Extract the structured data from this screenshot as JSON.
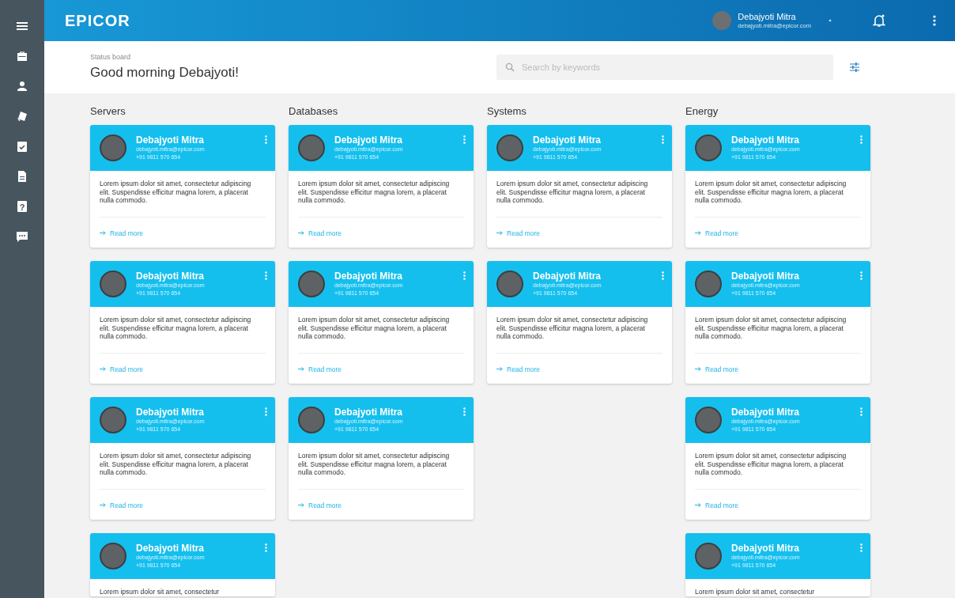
{
  "topbar": {
    "logo": "EPICOR",
    "user": {
      "name": "Debajyoti Mitra",
      "email": "debajyoti.mitra@epicor.com"
    }
  },
  "sidebar": {
    "items": [
      {
        "kind": "menu"
      },
      {
        "kind": "briefcase"
      },
      {
        "kind": "person"
      },
      {
        "kind": "tag"
      },
      {
        "kind": "clipboard"
      },
      {
        "kind": "document"
      },
      {
        "kind": "help",
        "glyph": "?"
      },
      {
        "kind": "chat"
      }
    ]
  },
  "page": {
    "breadcrumb": "Status board",
    "greeting": "Good morning Debajyoti!",
    "search": {
      "placeholder": "Search by keywords"
    }
  },
  "columns": [
    {
      "title": "Servers",
      "cards": [
        {
          "name": "Debajyoti Mitra",
          "email": "debajyoti.mitra@epicor.com",
          "phone": "+91 9811 570 654",
          "text": "Lorem ipsum dolor sit amet, consectetur adipiscing elit. Suspendisse efficitur magna lorem, a placerat nulla commodo.",
          "link": "Read more"
        },
        {
          "name": "Debajyoti Mitra",
          "email": "debajyoti.mitra@epicor.com",
          "phone": "+91 9811 570 654",
          "text": "Lorem ipsum dolor sit amet, consectetur adipiscing elit. Suspendisse efficitur magna lorem, a placerat nulla commodo.",
          "link": "Read more"
        },
        {
          "name": "Debajyoti Mitra",
          "email": "debajyoti.mitra@epicor.com",
          "phone": "+91 9811 570 654",
          "text": "Lorem ipsum dolor sit amet, consectetur adipiscing elit. Suspendisse efficitur magna lorem, a placerat nulla commodo.",
          "link": "Read more"
        },
        {
          "name": "Debajyoti Mitra",
          "email": "debajyoti.mitra@epicor.com",
          "phone": "+91 9811 570 654",
          "text": "Lorem ipsum dolor sit amet, consectetur"
        }
      ]
    },
    {
      "title": "Databases",
      "cards": [
        {
          "name": "Debajyoti Mitra",
          "email": "debajyoti.mitra@epicor.com",
          "phone": "+91 9811 570 654",
          "text": "Lorem ipsum dolor sit amet, consectetur adipiscing elit. Suspendisse efficitur magna lorem, a placerat nulla commodo.",
          "link": "Read more"
        },
        {
          "name": "Debajyoti Mitra",
          "email": "debajyoti.mitra@epicor.com",
          "phone": "+91 9811 570 654",
          "text": "Lorem ipsum dolor sit amet, consectetur adipiscing elit. Suspendisse efficitur magna lorem, a placerat nulla commodo.",
          "link": "Read more"
        },
        {
          "name": "Debajyoti Mitra",
          "email": "debajyoti.mitra@epicor.com",
          "phone": "+91 9811 570 654",
          "text": "Lorem ipsum dolor sit amet, consectetur adipiscing elit. Suspendisse efficitur magna lorem, a placerat nulla commodo.",
          "link": "Read more"
        }
      ]
    },
    {
      "title": "Systems",
      "cards": [
        {
          "name": "Debajyoti Mitra",
          "email": "debajyoti.mitra@epicor.com",
          "phone": "+91 9811 570 654",
          "text": "Lorem ipsum dolor sit amet, consectetur adipiscing elit. Suspendisse efficitur magna lorem, a placerat nulla commodo.",
          "link": "Read more"
        },
        {
          "name": "Debajyoti Mitra",
          "email": "debajyoti.mitra@epicor.com",
          "phone": "+91 9811 570 654",
          "text": "Lorem ipsum dolor sit amet, consectetur adipiscing elit. Suspendisse efficitur magna lorem, a placerat nulla commodo.",
          "link": "Read more"
        }
      ]
    },
    {
      "title": "Energy",
      "cards": [
        {
          "name": "Debajyoti Mitra",
          "email": "debajyoti.mitra@epicor.com",
          "phone": "+91 9811 570 654",
          "text": "Lorem ipsum dolor sit amet, consectetur adipiscing elit. Suspendisse efficitur magna lorem, a placerat nulla commodo.",
          "link": "Read more"
        },
        {
          "name": "Debajyoti Mitra",
          "email": "debajyoti.mitra@epicor.com",
          "phone": "+91 9811 570 654",
          "text": "Lorem ipsum dolor sit amet, consectetur adipiscing elit. Suspendisse efficitur magna lorem, a placerat nulla commodo.",
          "link": "Read more"
        },
        {
          "name": "Debajyoti Mitra",
          "email": "debajyoti.mitra@epicor.com",
          "phone": "+91 9811 570 654",
          "text": "Lorem ipsum dolor sit amet, consectetur adipiscing elit. Suspendisse efficitur magna lorem, a placerat nulla commodo.",
          "link": "Read more"
        },
        {
          "name": "Debajyoti Mitra",
          "email": "debajyoti.mitra@epicor.com",
          "phone": "+91 9811 570 654",
          "text": "Lorem ipsum dolor sit amet, consectetur"
        }
      ]
    }
  ]
}
